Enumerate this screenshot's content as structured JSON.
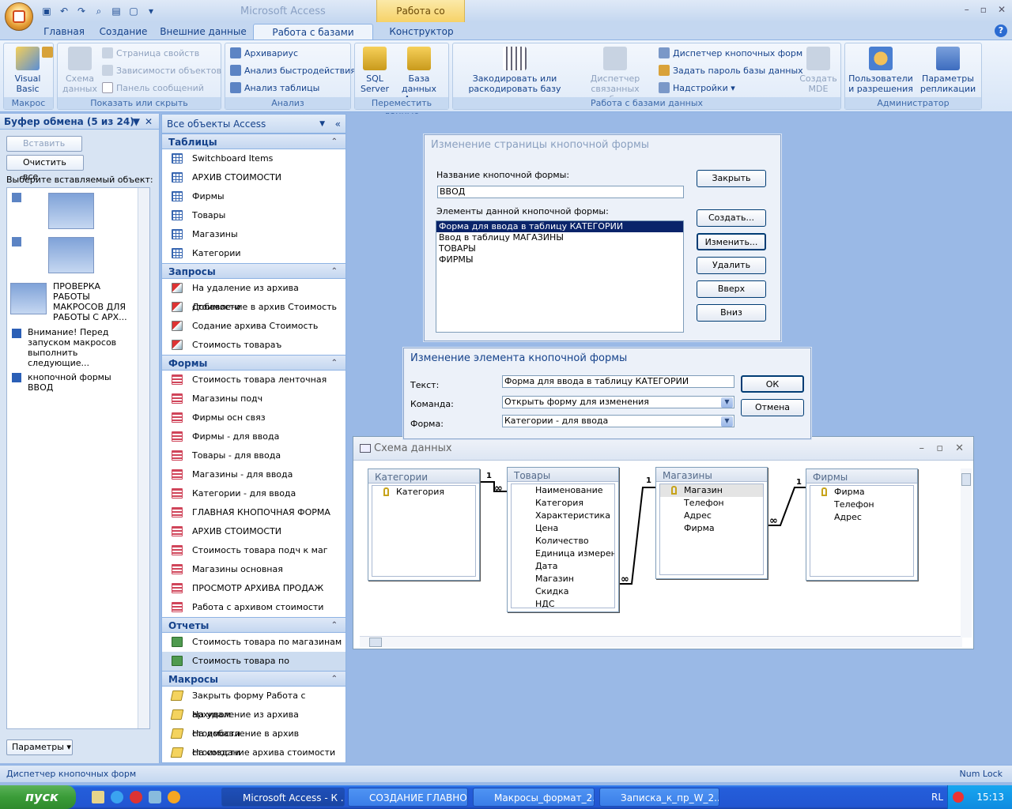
{
  "titlebar": {
    "app_title": "Microsoft Access",
    "context_tab": "Работа со связями"
  },
  "tabs": [
    "Главная",
    "Создание",
    "Внешние данные",
    "Работа с базами данных",
    "Конструктор"
  ],
  "ribbon": {
    "macro": {
      "vb": "Visual Basic",
      "label": "Макрос"
    },
    "show": {
      "schema": "Схема данных",
      "props": "Страница свойств",
      "deps": "Зависимости объектов",
      "msgs": "Панель сообщений",
      "label": "Показать или скрыть"
    },
    "analysis": {
      "archiver": "Архивариус",
      "perf": "Анализ быстродействия",
      "table": "Анализ таблицы",
      "label": "Анализ"
    },
    "move": {
      "sql": "SQL Server",
      "access": "База данных Access",
      "label": "Переместить данные"
    },
    "db": {
      "encode": "Закодировать или раскодировать базу данных",
      "linked": "Диспетчер связанных таблиц",
      "switchboard": "Диспетчер кнопочных форм",
      "password": "Задать пароль базы данных",
      "addins": "Надстройки",
      "mde": "Создать MDE",
      "label": "Работа с базами данных"
    },
    "admin": {
      "users": "Пользователи и разрешения",
      "replication": "Параметры репликации",
      "label": "Администратор"
    }
  },
  "clipboard": {
    "title": "Буфер обмена (5 из 24)",
    "paste_all": "Вставить все",
    "clear_all": "Очистить все",
    "prompt": "Выберите вставляемый объект:",
    "items": [
      "ПРОВЕРКА РАБОТЫ МАКРОСОВ ДЛЯ РАБОТЫ С АРХ...",
      "Внимание! Перед запуском макросов выполнить следующие...",
      "кнопочной формы ВВОД"
    ],
    "options": "Параметры"
  },
  "nav": {
    "title": "Все объекты Access",
    "sections": [
      {
        "title": "Таблицы",
        "type": "table",
        "items": [
          "Switchboard Items",
          "АРХИВ СТОИМОСТИ",
          "Фирмы",
          "Товары",
          "Магазины",
          "Категории"
        ]
      },
      {
        "title": "Запросы",
        "type": "query",
        "items": [
          "На удаление из архива стоимости",
          "Добавление в архив Стоимость",
          "Содание архива Стоимость",
          "Стоимость товараъ"
        ]
      },
      {
        "title": "Формы",
        "type": "form",
        "items": [
          "Стоимость товара ленточная",
          "Магазины подч",
          "Фирмы осн связ",
          "Фирмы - для ввода",
          "Товары - для ввода",
          "Магазины - для ввода",
          "Категории - для ввода",
          "ГЛАВНАЯ КНОПОЧНАЯ ФОРМА",
          "АРХИВ СТОИМОСТИ",
          "Стоимость товара подч к маг",
          "Магазины основная",
          "ПРОСМОТР АРХИВА ПРОДАЖ",
          "Работа с архивом стоимости"
        ]
      },
      {
        "title": "Отчеты",
        "type": "report",
        "items": [
          "Стоимость товара по магазинам",
          "Стоимость товара по категориям"
        ]
      },
      {
        "title": "Макросы",
        "type": "macro",
        "items": [
          "Закрыть форму Работа с архивом",
          "На удаление из архива стоимости",
          "На добавление в архив стоимости",
          "На создание архива стоимости"
        ]
      }
    ]
  },
  "page_dialog": {
    "title": "Изменение страницы кнопочной формы",
    "name_label": "Название кнопочной формы:",
    "name_value": "ВВОД",
    "elements_label": "Элементы данной кнопочной формы:",
    "elements": [
      "Форма для ввода в таблицу КАТЕГОРИИ",
      "Ввод в таблицу МАГАЗИНЫ",
      "ТОВАРЫ",
      "ФИРМЫ"
    ],
    "buttons": [
      "Закрыть",
      "Создать...",
      "Изменить...",
      "Удалить",
      "Вверх",
      "Вниз"
    ]
  },
  "item_dialog": {
    "title": "Изменение элемента кнопочной формы",
    "text_label": "Текст:",
    "text_value": "Форма для ввода в таблицу КАТЕГОРИИ",
    "cmd_label": "Команда:",
    "cmd_value": "Открыть форму для изменения",
    "form_label": "Форма:",
    "form_value": "Категории - для ввода",
    "ok": "ОК",
    "cancel": "Отмена"
  },
  "schema": {
    "title": "Схема данных",
    "tables": [
      {
        "name": "Категории",
        "fields": [
          "Категория"
        ],
        "key": 0
      },
      {
        "name": "Товары",
        "fields": [
          "Наименование",
          "Категория",
          "Характеристика",
          "Цена",
          "Количество",
          "Единица измерения",
          "Дата",
          "Магазин",
          "Скидка",
          "НДС"
        ],
        "key": -1
      },
      {
        "name": "Магазины",
        "fields": [
          "Магазин",
          "Телефон",
          "Адрес",
          "Фирма"
        ],
        "key": 0
      },
      {
        "name": "Фирмы",
        "fields": [
          "Фирма",
          "Телефон",
          "Адрес"
        ],
        "key": 0
      }
    ],
    "one": "1",
    "many": "∞"
  },
  "status": {
    "left": "Диспетчер кнопочных форм",
    "right": "Num Lock"
  },
  "taskbar": {
    "start": "пуск",
    "tasks": [
      "Microsoft Access - К ...",
      "СОЗДАНИЕ ГЛАВНО...",
      "Макросы_формат_2...",
      "Записка_к_пр_W_2..."
    ],
    "lang": "RL",
    "time": "15:13"
  }
}
